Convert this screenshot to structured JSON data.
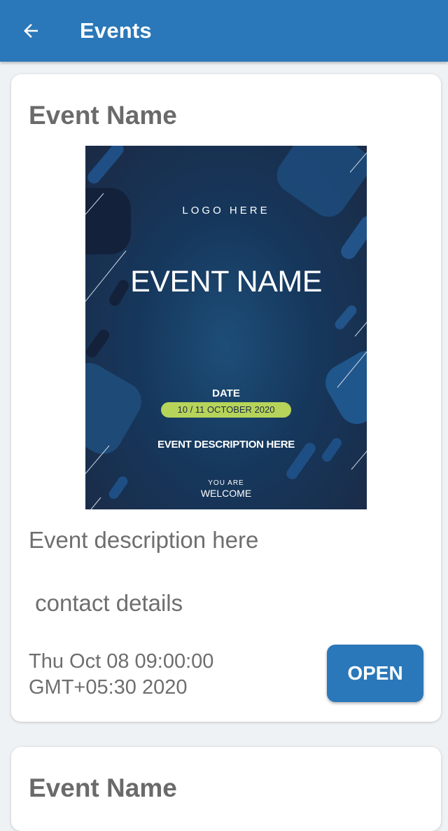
{
  "appbar": {
    "title": "Events",
    "back_icon": "arrow-left-icon",
    "color": "#2a78b9"
  },
  "events": [
    {
      "name": "Event Name",
      "poster": {
        "logo_text": "LOGO HERE",
        "event_name": "EVENT NAME",
        "date_label": "DATE",
        "date_value": "10 / 11 OCTOBER 2020",
        "description": "EVENT DESCRIPTION HERE",
        "you_are": "YOU ARE",
        "welcome": "WELCOME"
      },
      "description": "Event description here",
      "contact": " contact details",
      "datetime": "Thu Oct 08 09:00:00 GMT+05:30 2020",
      "open_label": "OPEN"
    },
    {
      "name": "Event Name"
    }
  ]
}
